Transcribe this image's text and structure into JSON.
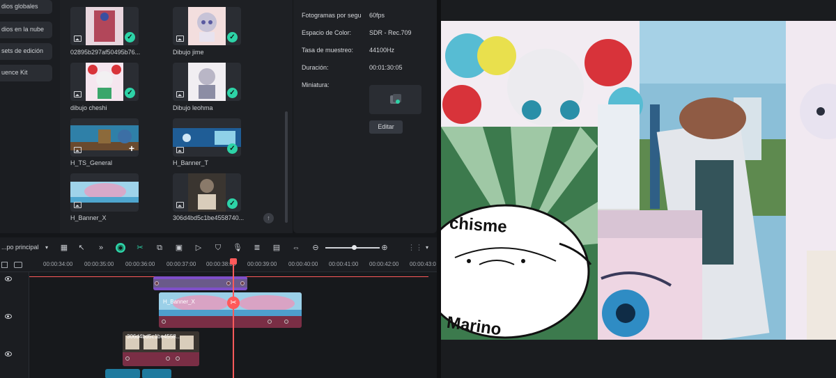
{
  "nav": {
    "items": [
      "dios globales",
      "dios en la nube",
      "sets de edición",
      "uence Kit"
    ]
  },
  "media": {
    "items": [
      {
        "label": "02895b297af50495b76...",
        "status": "check"
      },
      {
        "label": "Dibujo jime",
        "status": "check"
      },
      {
        "label": "dibujo cheshi",
        "status": "check"
      },
      {
        "label": "Dibujo leohma",
        "status": "check"
      },
      {
        "label": "H_TS_General",
        "status": "plus"
      },
      {
        "label": "H_Banner_T",
        "status": "check"
      },
      {
        "label": "H_Banner_X",
        "status": "none"
      },
      {
        "label": "306d4bd5c1be4558740...",
        "status": "check"
      }
    ]
  },
  "props": {
    "fps_label": "Fotogramas por segu",
    "fps_value": "60fps",
    "color_label": "Espacio de Color:",
    "color_value": "SDR - Rec.709",
    "sample_label": "Tasa de muestreo:",
    "sample_value": "44100Hz",
    "duration_label": "Duración:",
    "duration_value": "00:01:30:05",
    "thumb_label": "Miniatura:",
    "edit_button": "Editar"
  },
  "timeline": {
    "track_select": "...po principal",
    "ruler": [
      "00:00:34:00",
      "00:00:35:00",
      "00:00:36:00",
      "00:00:37:00",
      "00:00:38:00",
      "00:00:39:00",
      "00:00:40:00",
      "00:00:41:00",
      "00:00:42:00",
      "00:00:43:0"
    ],
    "clips": [
      "H_Banner_X",
      "306d4bd5c1be4558..."
    ]
  },
  "preview": {
    "sticker_text_top": "chisme",
    "sticker_text_bottom": "Marino"
  },
  "colors": {
    "accent": "#2dd3a7",
    "playhead": "#ff5a5a",
    "purple_track": "#7f4fc9"
  }
}
